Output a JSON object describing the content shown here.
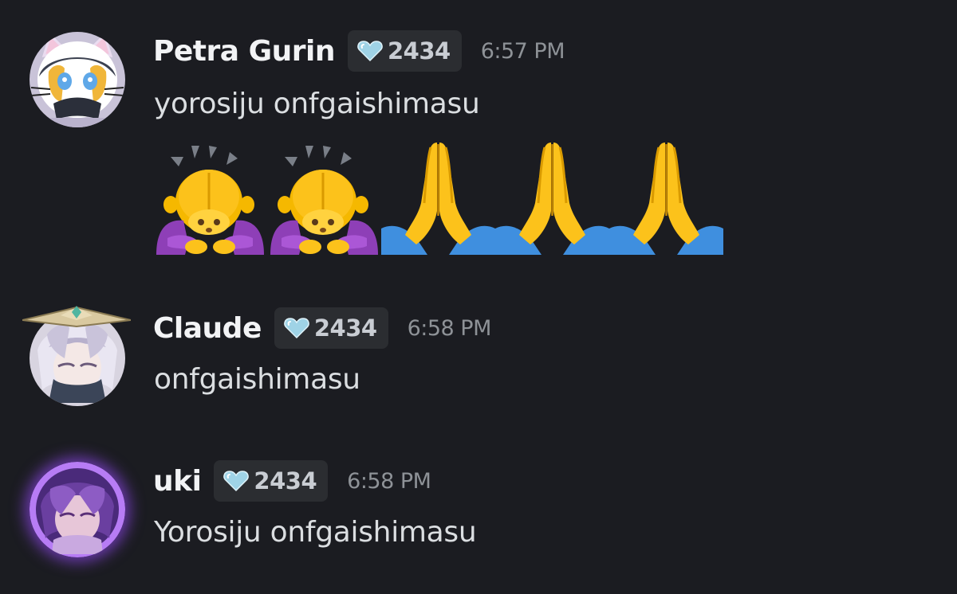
{
  "messages": [
    {
      "username": "Petra Gurin",
      "badge_count": "2434",
      "badge_icon": "heart-gem-icon",
      "time": "6:57 PM",
      "text": "yorosiju onfgaishimasu",
      "emojis": [
        "person-bowing",
        "person-bowing",
        "folded-hands",
        "folded-hands",
        "folded-hands"
      ],
      "avatar": "cat-eared-anime-avatar"
    },
    {
      "username": "Claude",
      "badge_count": "2434",
      "badge_icon": "heart-gem-icon",
      "time": "6:58 PM",
      "text": "onfgaishimasu",
      "avatar": "silver-haired-anime-avatar"
    },
    {
      "username": "uki",
      "badge_count": "2434",
      "badge_icon": "heart-gem-icon",
      "time": "6:58 PM",
      "text": "Yorosiju onfgaishimasu",
      "avatar": "purple-glow-anime-avatar"
    }
  ],
  "colors": {
    "background": "#1b1c21",
    "username": "#f2f3f5",
    "message_text": "#dbdee1",
    "timestamp": "#8e9297",
    "badge_bg": "#2b2d31",
    "badge_heart": "#a8d8e8"
  }
}
